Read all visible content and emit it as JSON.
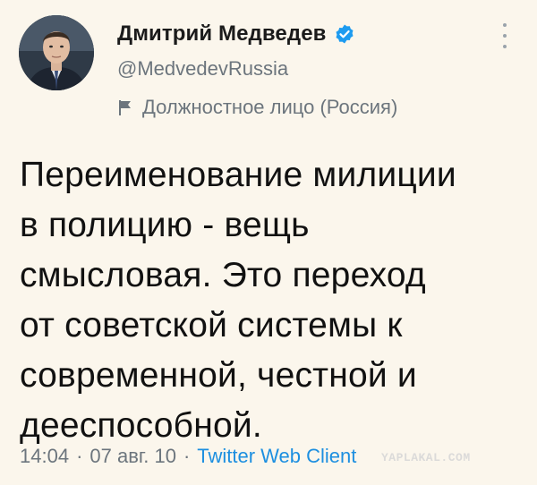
{
  "author": {
    "name": "Дмитрий Медведев",
    "handle": "@MedvedevRussia",
    "label": "Должностное лицо (Россия)",
    "avatar_icon": "person-portrait",
    "verified_icon": "verified-badge-icon",
    "label_icon": "flag-icon"
  },
  "tweet": {
    "text": "Переименование милиции\nв полицию - вещь\nсмысловая. Это переход\nот советской системы к\nсовременной, честной и\nдееспособной."
  },
  "meta": {
    "time": "14:04",
    "separator": "·",
    "date": "07 авг. 10",
    "source": "Twitter Web Client"
  },
  "watermark": "YAPLAKAL.COM",
  "colors": {
    "background": "#fbf6ec",
    "text": "#111111",
    "secondary": "#6c757d",
    "link": "#1d8fe0",
    "verified": "#1d9bf0"
  }
}
